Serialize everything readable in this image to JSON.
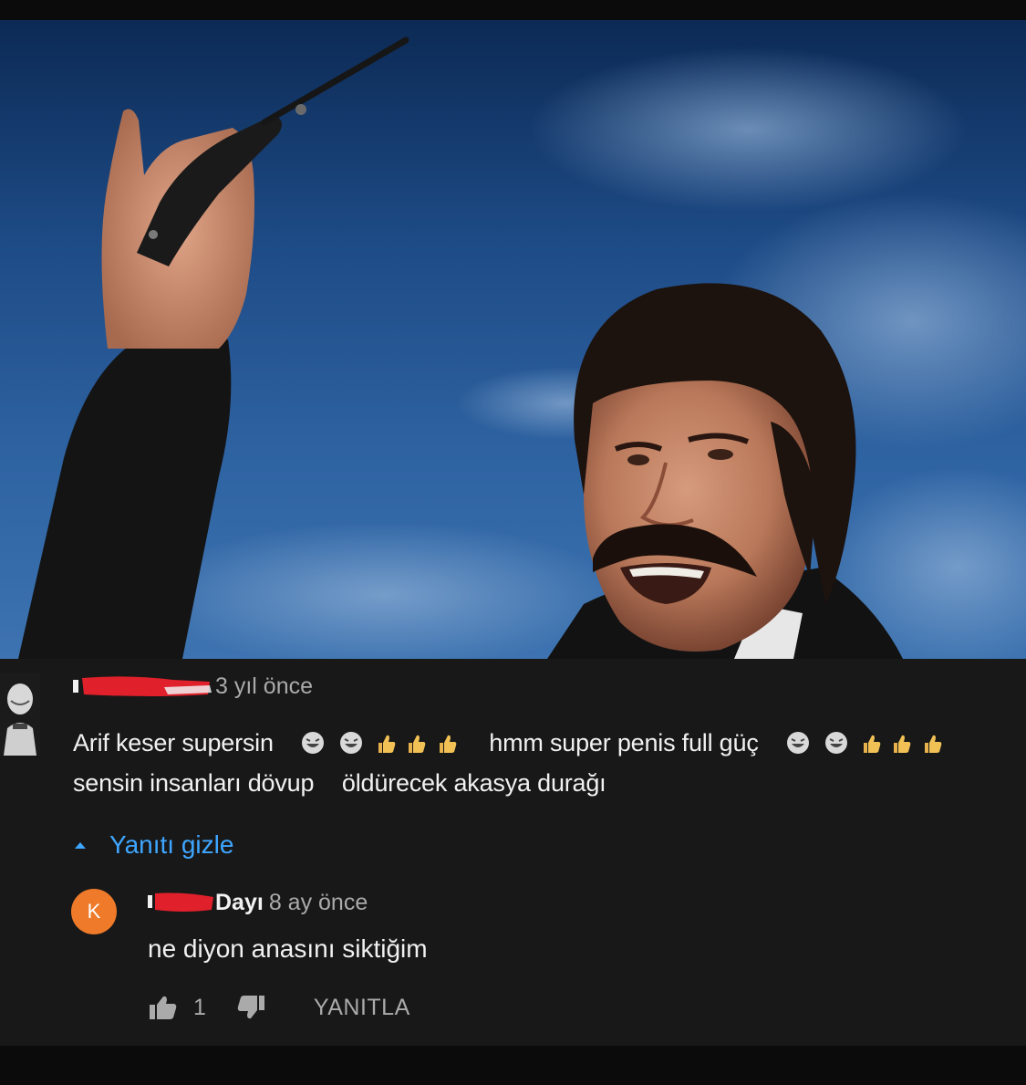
{
  "comment": {
    "time": "3 yıl önce",
    "text_part1": "Arif keser supersin",
    "text_part2": "hmm super penis full güç",
    "text_line2_a": "sensin insanları dövup",
    "text_line2_b": "öldürecek akasya durağı",
    "laugh_icon": "laughing-face-emoji",
    "thumb_icon": "thumbs-up-emoji"
  },
  "toggle": {
    "label": "Yanıtı gizle",
    "icon": "caret-up-icon"
  },
  "reply": {
    "avatar_letter": "K",
    "avatar_color": "#ef7a2a",
    "author_visible": "Dayı",
    "time": "8 ay önce",
    "text": "ne diyon anasını siktiğim",
    "like_count": "1",
    "reply_label": "YANITLA"
  },
  "colors": {
    "panel_bg": "#181818",
    "link_blue": "#3ea6ff",
    "redaction": "#e0202a"
  }
}
